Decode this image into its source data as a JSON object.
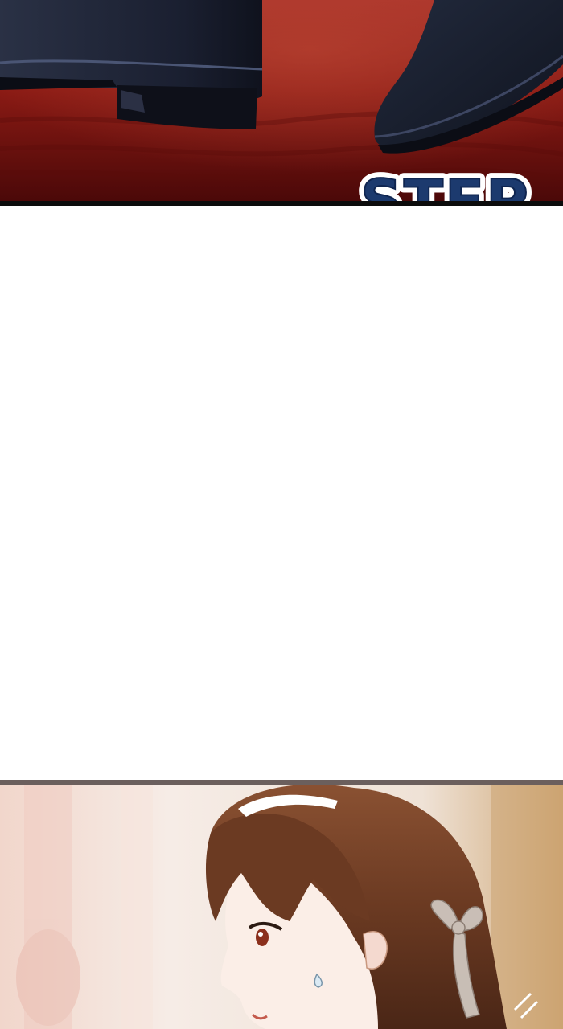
{
  "page": {
    "background": "#ffffff"
  },
  "top_panel": {
    "scene": "shoes-on-red-carpet",
    "colors": {
      "carpet_dark": "#4a0808",
      "carpet_mid": "#8a1a14",
      "carpet_light": "#a8322a",
      "shoe_dark": "#15192a",
      "shoe_mid": "#2a3145",
      "border": "#0c0c0c"
    }
  },
  "sfx": {
    "text": "STEP",
    "fill": "#1c3a6e",
    "outline": "#ffffff"
  },
  "bottom_panel": {
    "scene": "girl-profile-with-ribbon",
    "colors": {
      "background_light": "#f3e2d8",
      "background_gold": "#d8b98e",
      "hair": "#6b3a22",
      "hair_shadow": "#3e1f12",
      "skin": "#fbeee7",
      "headband": "#ffffff",
      "ribbon": "#cfc6be",
      "border": "#6b5f5d"
    }
  }
}
